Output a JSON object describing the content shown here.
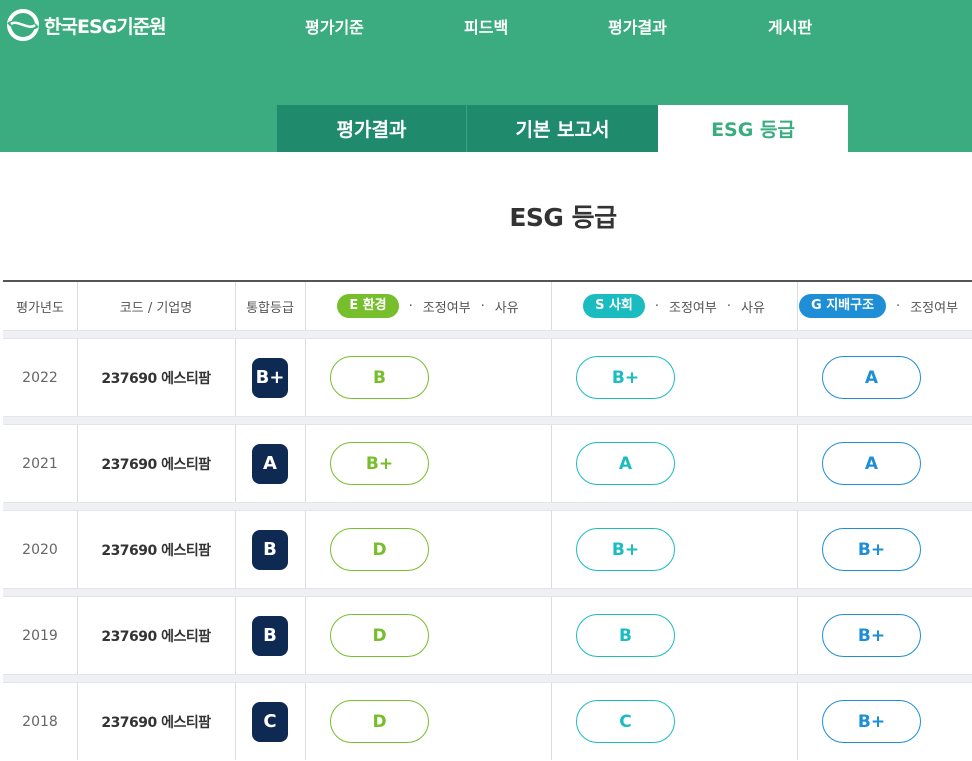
{
  "header": {
    "logo_text": "한국ESG기준원",
    "nav": [
      "평가기준",
      "피드백",
      "평가결과",
      "게시판"
    ],
    "subtabs": [
      "평가결과",
      "기본 보고서",
      "ESG 등급"
    ],
    "active_subtab": "ESG 등급"
  },
  "page_title": "ESG 등급",
  "table": {
    "headers": {
      "year": "평가년도",
      "company": "코드 / 기업명",
      "total": "통합등급",
      "e_label": "E 환경",
      "s_label": "S 사회",
      "g_label": "G 지배구조",
      "adjust": "조정여부",
      "reason": "사유",
      "dot": "·"
    },
    "rows": [
      {
        "year": "2022",
        "company": "237690 에스티팜",
        "total": "B+",
        "e": "B",
        "s": "B+",
        "g": "A"
      },
      {
        "year": "2021",
        "company": "237690 에스티팜",
        "total": "A",
        "e": "B+",
        "s": "A",
        "g": "A"
      },
      {
        "year": "2020",
        "company": "237690 에스티팜",
        "total": "B",
        "e": "D",
        "s": "B+",
        "g": "B+"
      },
      {
        "year": "2019",
        "company": "237690 에스티팜",
        "total": "B",
        "e": "D",
        "s": "B",
        "g": "B+"
      },
      {
        "year": "2018",
        "company": "237690 에스티팜",
        "total": "C",
        "e": "D",
        "s": "C",
        "g": "B+"
      }
    ]
  },
  "colors": {
    "header_bg": "#3aac7f",
    "subtab_bg": "#1f8a6c",
    "badge_bg": "#0e2a52",
    "e_color": "#77be2c",
    "s_color": "#1bbcc0",
    "g_color": "#1e8fd6"
  }
}
